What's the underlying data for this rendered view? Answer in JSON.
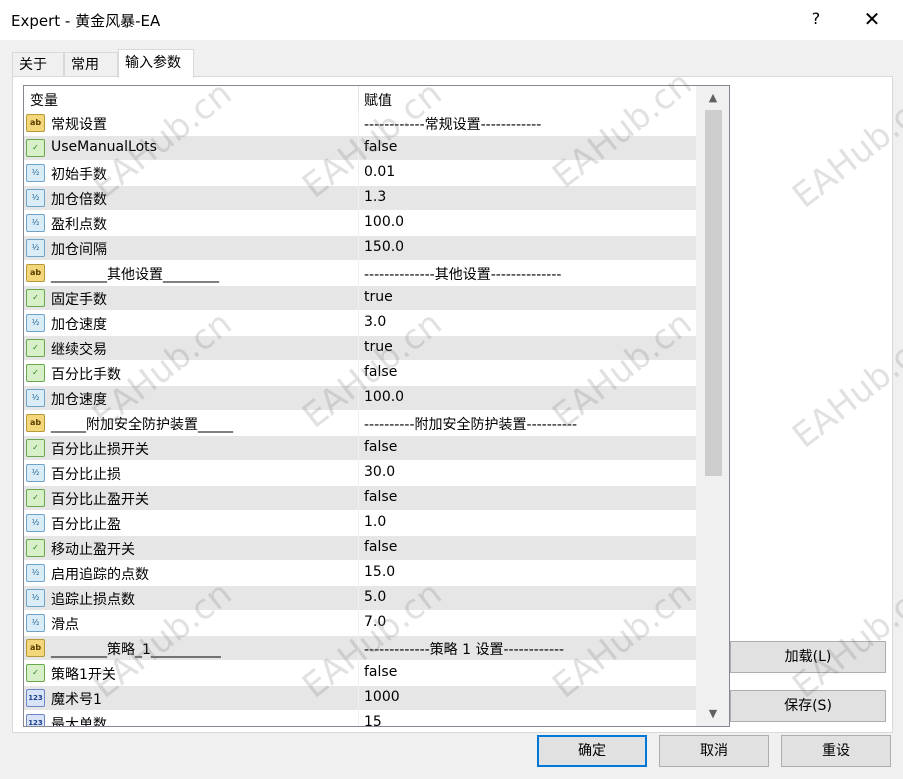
{
  "window": {
    "title": "Expert - 黄金风暴-EA",
    "help": "?",
    "close": "✕"
  },
  "tabs": [
    "关于",
    "常用",
    "输入参数"
  ],
  "grid": {
    "col_variable": "变量",
    "col_value": "赋值",
    "rows": [
      {
        "type": "ab",
        "name": "常规设置",
        "value": "------------常规设置------------"
      },
      {
        "type": "bool",
        "name": "UseManualLots",
        "value": "false"
      },
      {
        "type": "dbl",
        "name": "初始手数",
        "value": "0.01"
      },
      {
        "type": "dbl",
        "name": "加仓倍数",
        "value": "1.3"
      },
      {
        "type": "dbl",
        "name": "盈利点数",
        "value": "100.0"
      },
      {
        "type": "dbl",
        "name": "加仓间隔",
        "value": "150.0"
      },
      {
        "type": "ab",
        "name": "________其他设置________",
        "value": "--------------其他设置--------------"
      },
      {
        "type": "bool",
        "name": "固定手数",
        "value": "true"
      },
      {
        "type": "dbl",
        "name": "加仓速度",
        "value": "3.0"
      },
      {
        "type": "bool",
        "name": "继续交易",
        "value": "true"
      },
      {
        "type": "bool",
        "name": "百分比手数",
        "value": "false"
      },
      {
        "type": "dbl",
        "name": "加仓速度",
        "value": "100.0"
      },
      {
        "type": "ab",
        "name": "_____附加安全防护装置_____",
        "value": "----------附加安全防护装置----------"
      },
      {
        "type": "bool",
        "name": "百分比止损开关",
        "value": "false"
      },
      {
        "type": "dbl",
        "name": "百分比止损",
        "value": "30.0"
      },
      {
        "type": "bool",
        "name": "百分比止盈开关",
        "value": "false"
      },
      {
        "type": "dbl",
        "name": "百分比止盈",
        "value": "1.0"
      },
      {
        "type": "bool",
        "name": "移动止盈开关",
        "value": "false"
      },
      {
        "type": "dbl",
        "name": "启用追踪的点数",
        "value": "15.0"
      },
      {
        "type": "dbl",
        "name": "追踪止损点数",
        "value": "5.0"
      },
      {
        "type": "dbl",
        "name": "滑点",
        "value": "7.0"
      },
      {
        "type": "ab",
        "name": "________策略_1__________",
        "value": "-------------策略 1 设置------------"
      },
      {
        "type": "bool",
        "name": "策略1开关",
        "value": "false"
      },
      {
        "type": "int",
        "name": "魔术号1",
        "value": "1000"
      },
      {
        "type": "int",
        "name": "最大单数",
        "value": "15"
      }
    ]
  },
  "icons": {
    "ab": "ab",
    "bool": "✓",
    "dbl": "½",
    "int": "123"
  },
  "side_buttons": {
    "load": "加载(L)",
    "save": "保存(S)"
  },
  "buttons": {
    "ok": "确定",
    "cancel": "取消",
    "reset": "重设"
  },
  "watermark": "EAHub.cn",
  "colors": {
    "alt_row": "#e6e6e6",
    "ok_border": "#0078d7"
  }
}
